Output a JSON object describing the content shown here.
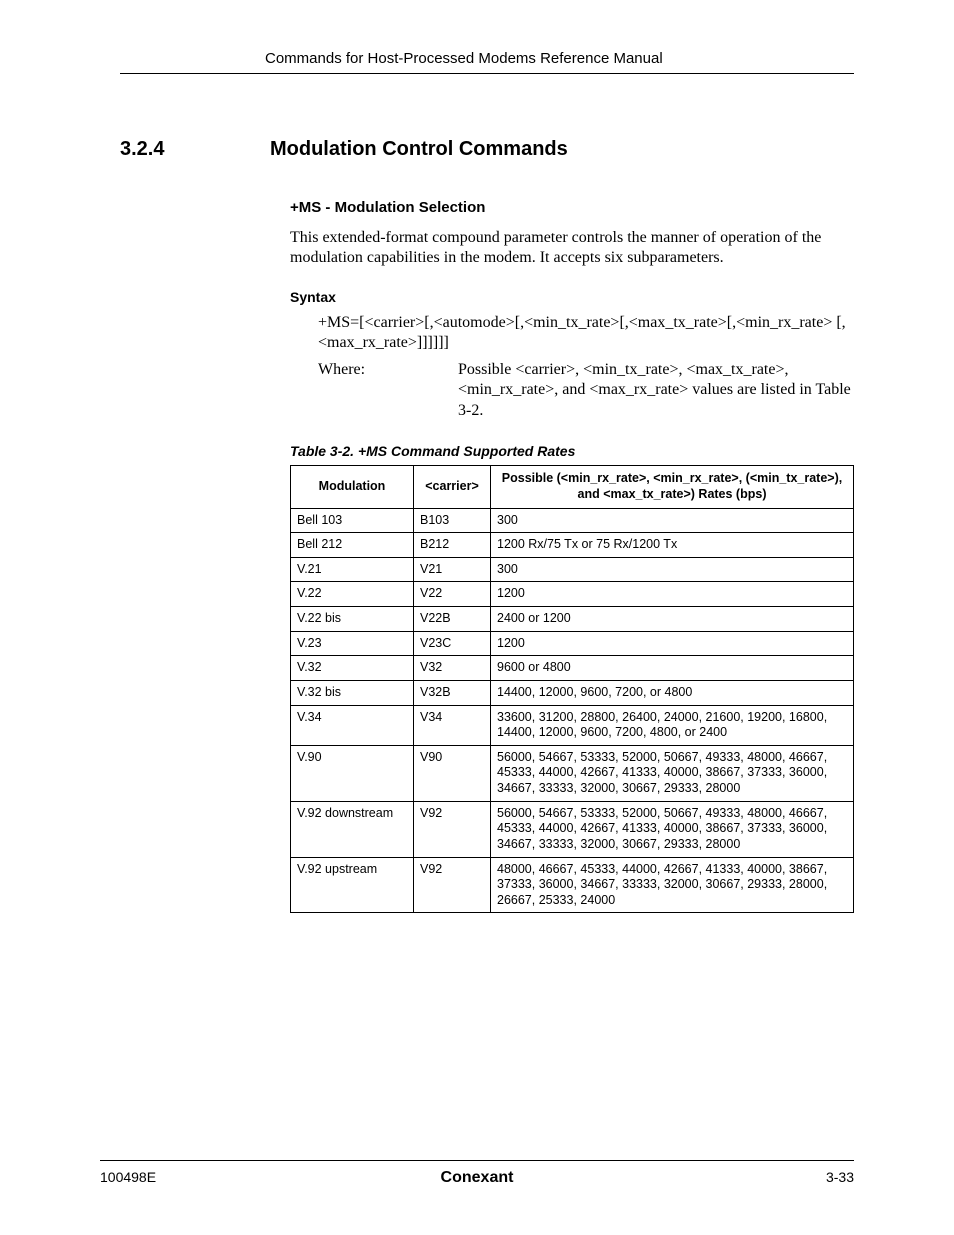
{
  "header": {
    "running": "Commands for Host-Processed Modems Reference Manual"
  },
  "section": {
    "number": "3.2.4",
    "title": "Modulation Control Commands"
  },
  "ms": {
    "heading": "+MS - Modulation Selection",
    "description": "This extended-format compound parameter controls the manner of operation of the modulation capabilities in the modem. It accepts six subparameters.",
    "syntax_label": "Syntax",
    "syntax_line": "+MS=[<carrier>[,<automode>[,<min_tx_rate>[,<max_tx_rate>[,<min_rx_rate> [,<max_rx_rate>]]]]]]",
    "where_label": "Where:",
    "where_text": "Possible <carrier>, <min_tx_rate>, <max_tx_rate>, <min_rx_rate>, and <max_rx_rate> values are listed in Table 3-2."
  },
  "table": {
    "caption": "Table 3-2. +MS Command Supported Rates",
    "headers": {
      "modulation": "Modulation",
      "carrier": "<carrier>",
      "rates": "Possible (<min_rx_rate>, <min_rx_rate>, (<min_tx_rate>), and <max_tx_rate>) Rates (bps)"
    },
    "rows": [
      {
        "modulation": "Bell 103",
        "carrier": "B103",
        "rates": "300"
      },
      {
        "modulation": "Bell 212",
        "carrier": "B212",
        "rates": "1200 Rx/75 Tx or 75 Rx/1200 Tx"
      },
      {
        "modulation": "V.21",
        "carrier": "V21",
        "rates": "300"
      },
      {
        "modulation": "V.22",
        "carrier": "V22",
        "rates": "1200"
      },
      {
        "modulation": "V.22 bis",
        "carrier": "V22B",
        "rates": "2400 or 1200"
      },
      {
        "modulation": "V.23",
        "carrier": "V23C",
        "rates": "1200"
      },
      {
        "modulation": "V.32",
        "carrier": "V32",
        "rates": "9600 or 4800"
      },
      {
        "modulation": "V.32 bis",
        "carrier": "V32B",
        "rates": "14400, 12000, 9600, 7200, or 4800"
      },
      {
        "modulation": "V.34",
        "carrier": "V34",
        "rates": "33600, 31200, 28800, 26400, 24000, 21600, 19200, 16800, 14400, 12000, 9600, 7200, 4800, or 2400"
      },
      {
        "modulation": "V.90",
        "carrier": "V90",
        "rates": "56000, 54667, 53333, 52000, 50667, 49333, 48000, 46667, 45333, 44000, 42667, 41333, 40000, 38667, 37333, 36000, 34667, 33333, 32000, 30667, 29333, 28000"
      },
      {
        "modulation": "V.92 downstream",
        "carrier": "V92",
        "rates": "56000, 54667, 53333, 52000, 50667, 49333, 48000, 46667, 45333, 44000, 42667, 41333, 40000, 38667, 37333, 36000, 34667, 33333, 32000, 30667, 29333, 28000"
      },
      {
        "modulation": "V.92 upstream",
        "carrier": "V92",
        "rates": "48000, 46667, 45333, 44000, 42667, 41333, 40000, 38667, 37333, 36000, 34667, 33333, 32000, 30667, 29333, 28000, 26667, 25333, 24000"
      }
    ]
  },
  "footer": {
    "left": "100498E",
    "center": "Conexant",
    "right": "3-33"
  }
}
